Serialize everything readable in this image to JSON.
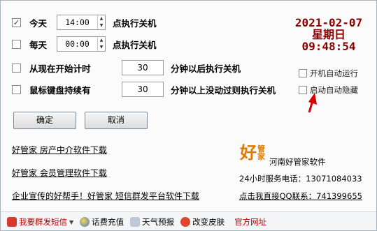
{
  "schedule": {
    "today": {
      "checked": true,
      "label": "今天",
      "time": "14:00",
      "action": "点执行关机"
    },
    "everyday": {
      "checked": false,
      "label": "每天",
      "time": "00:00",
      "action": "点执行关机"
    },
    "countdown": {
      "checked": false,
      "label": "从现在开始计时",
      "value": "30",
      "action": "分钟以后执行关机"
    },
    "idle": {
      "checked": false,
      "label": "鼠标键盘持续有",
      "value": "30",
      "action": "分钟以上没动过则执行关机"
    }
  },
  "clock": {
    "date": "2021-02-07",
    "weekday": "星期日",
    "time": "09:48:54"
  },
  "options": {
    "autostart_label": "开机自动运行",
    "autohide_label": "启动自动隐藏"
  },
  "buttons": {
    "confirm": "确定",
    "cancel": "取消"
  },
  "links": [
    "好管家 房产中介软件下载",
    "好管家 会员管理软件下载",
    "企业宣传的好帮手！好管家 短信群发平台软件下载"
  ],
  "company": {
    "logo_big": "好",
    "logo_small_1": "管",
    "logo_small_2": "家",
    "name": "河南好管家软件",
    "hotline": "24小时服务电话：13071084033",
    "qq": "点击我直接QQ联系：741399655"
  },
  "bottom_bar": {
    "sms": "我要群发短信",
    "recharge": "话费充值",
    "weather": "天气预报",
    "skin": "改变皮肤",
    "website": "官方网址"
  },
  "colors": {
    "clock": "#8b0000",
    "logo": "#e07a00",
    "arrow": "#d40000"
  }
}
